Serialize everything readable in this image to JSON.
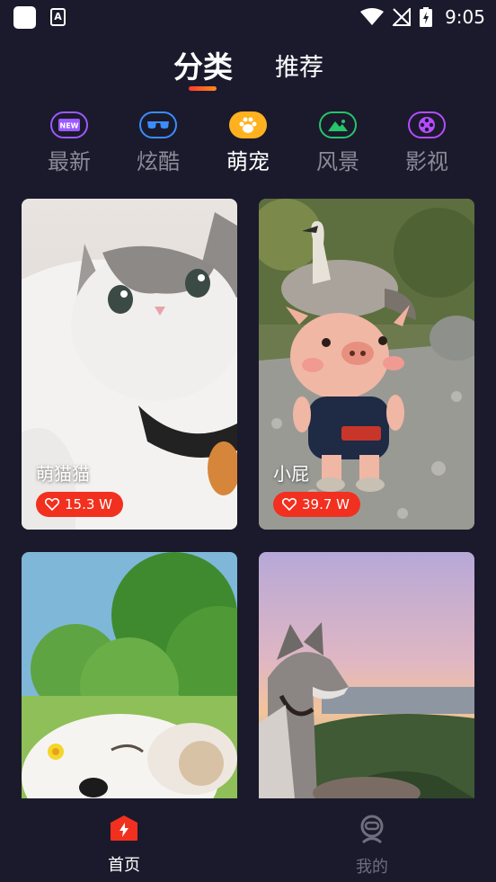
{
  "status_bar": {
    "time": "9:05"
  },
  "top_tabs": [
    {
      "label": "分类",
      "active": true
    },
    {
      "label": "推荐",
      "active": false
    }
  ],
  "categories": [
    {
      "label": "最新",
      "icon": "new-badge-icon",
      "color": "#9b59ff",
      "active": false
    },
    {
      "label": "炫酷",
      "icon": "sunglasses-icon",
      "color": "#3a8dff",
      "active": false
    },
    {
      "label": "萌宠",
      "icon": "paw-icon",
      "color": "#ffb21e",
      "active": true
    },
    {
      "label": "风景",
      "icon": "mountain-icon",
      "color": "#27c46a",
      "active": false
    },
    {
      "label": "影视",
      "icon": "film-reel-icon",
      "color": "#b44cff",
      "active": false
    }
  ],
  "cards": [
    {
      "title": "萌猫猫",
      "likes": "15.3 W",
      "image": "kitten-photo"
    },
    {
      "title": "小屁",
      "likes": "39.7 W",
      "image": "pig-and-goose-photo"
    },
    {
      "title": "",
      "likes": "",
      "image": "white-puppy-photo"
    },
    {
      "title": "",
      "likes": "",
      "image": "husky-sunset-photo"
    }
  ],
  "bottom_nav": [
    {
      "label": "首页",
      "icon": "home-bolt-icon",
      "active": true
    },
    {
      "label": "我的",
      "icon": "profile-icon",
      "active": false
    }
  ],
  "colors": {
    "background": "#1b1a2c",
    "accent": "#f2301f",
    "inactive_text": "#8a8a99"
  }
}
